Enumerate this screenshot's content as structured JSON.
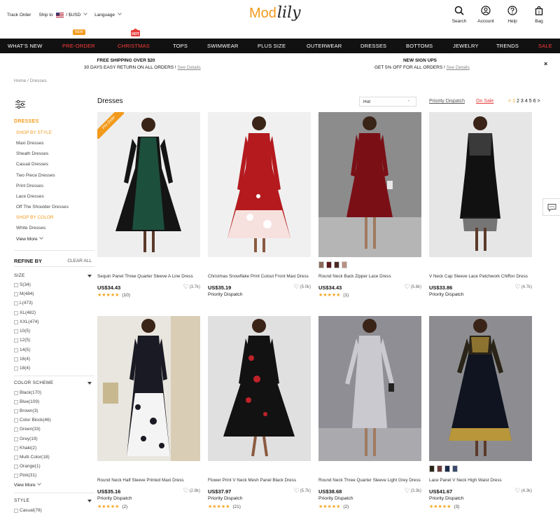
{
  "topbar": {
    "track_order": "Track Order",
    "ship_to": "Ship to",
    "currency": "/ $USD",
    "language": "Language",
    "logo_mod": "Mod",
    "logo_lily": "lily",
    "search": "Search",
    "account": "Account",
    "help": "Help",
    "bag": "Bag",
    "bag_count": "0"
  },
  "nav": {
    "items": [
      "WHAT'S NEW",
      "PRE-ORDER",
      "CHRISTMAS",
      "TOPS",
      "SWIMWEAR",
      "PLUS SIZE",
      "OUTERWEAR",
      "DRESSES",
      "BOTTOMS",
      "JEWELRY",
      "TRENDS",
      "SALE"
    ],
    "badge_new": "NEW",
    "badge_hot": "HOT"
  },
  "promo": {
    "left_title": "FREE SHIPPING OVER $20",
    "left_text": "30 DAYS EASY RETURN ON ALL ORDERS !",
    "left_link": "See Details",
    "right_title": "NEW SIGN UPS",
    "right_text": "GET 5% OFF FOR ALL ORDERS !",
    "right_link": "See Details",
    "close": "×"
  },
  "breadcrumb": "Home / Dresses",
  "sidebar": {
    "dresses": "DRESSES",
    "shop_by_style": "SHOP BY STYLE",
    "style_items": [
      "Maxi Dresses",
      "Sheath Dresses",
      "Casual Dresses",
      "Two Piece Dresses",
      "Print Dresses",
      "Lace Dresses",
      "Off The Shoulder Dresses"
    ],
    "shop_by_color": "SHOP BY COLOR",
    "color_items": [
      "White Dresses"
    ],
    "view_more": "View More",
    "refine_by": "REFINE BY",
    "clear_all": "CLEAR ALL",
    "size_label": "SIZE",
    "sizes": [
      "S(34)",
      "M(484)",
      "L(473)",
      "XL(482)",
      "XXL(474)",
      "10(5)",
      "12(5)",
      "14(5)",
      "16(4)",
      "18(4)"
    ],
    "color_label": "COLOR SCHEME",
    "colors": [
      "Black(170)",
      "Blue(109)",
      "Brown(3)",
      "Color Block(46)",
      "Green(33)",
      "Grey(19)",
      "Khaki(2)",
      "Multi Color(18)",
      "Orange(1)",
      "Pink(31)"
    ],
    "view_more_2": "View More",
    "style_label": "STYLE",
    "styles": [
      "Casual(78)"
    ]
  },
  "listing": {
    "title": "Dresses",
    "sort_value": "Hot",
    "sort_arrow": "-",
    "priority_dispatch": "Priority Dispatch",
    "on_sale": "On Sale",
    "pager_prev": "<",
    "pages": [
      "1",
      "2",
      "3",
      "4",
      "5",
      "6"
    ],
    "pager_next": ">"
  },
  "products": [
    {
      "name": "Sequin Panel Three Quarter Sleeve A Line Dress",
      "price": "US$34.43",
      "fav": "(3.7k)",
      "stars": "★★★★★",
      "reviews": "(10)",
      "sub": "",
      "preorder": "Pre Order"
    },
    {
      "name": "Christmas Snowflake Print Cutout Front Maxi Dress",
      "price": "US$35.19",
      "fav": "(5.0k)",
      "stars": "",
      "reviews": "",
      "sub": "Priority Dispatch"
    },
    {
      "name": "Round Neck Back Zipper Lace Dress",
      "price": "US$34.43",
      "fav": "(5.8k)",
      "stars": "★★★★★",
      "reviews": "(1)",
      "sub": ""
    },
    {
      "name": "V Neck Cap Sleeve Lace Patchwork Chiffon Dress",
      "price": "US$33.86",
      "fav": "(4.7k)",
      "stars": "",
      "reviews": "",
      "sub": "Priority Dispatch"
    },
    {
      "name": "Round Neck Half Sleeve Printed Maxi Dress",
      "price": "US$35.16",
      "fav": "(2.8k)",
      "stars": "★★★★★",
      "reviews": "(2)",
      "sub": "Priority Dispatch"
    },
    {
      "name": "Flower Print V Neck Mesh Panel Black Dress",
      "price": "US$37.97",
      "fav": "(5.7k)",
      "stars": "★★★★★",
      "reviews": "(21)",
      "sub": "Priority Dispatch"
    },
    {
      "name": "Round Neck Three Quarter Sleeve Light Grey Dress",
      "price": "US$38.68",
      "fav": "(3.3k)",
      "stars": "★★★★★",
      "reviews": "(2)",
      "sub": "Priority Dispatch"
    },
    {
      "name": "Lace Panel V Neck High Waist Dress",
      "price": "US$41.67",
      "fav": "(4.3k)",
      "stars": "★★★★★",
      "reviews": "(3)",
      "sub": "Priority Dispatch"
    }
  ],
  "colors": {
    "accent": "#f29a1c",
    "sale_red": "#e93d3d",
    "nav_bg": "#111111"
  }
}
